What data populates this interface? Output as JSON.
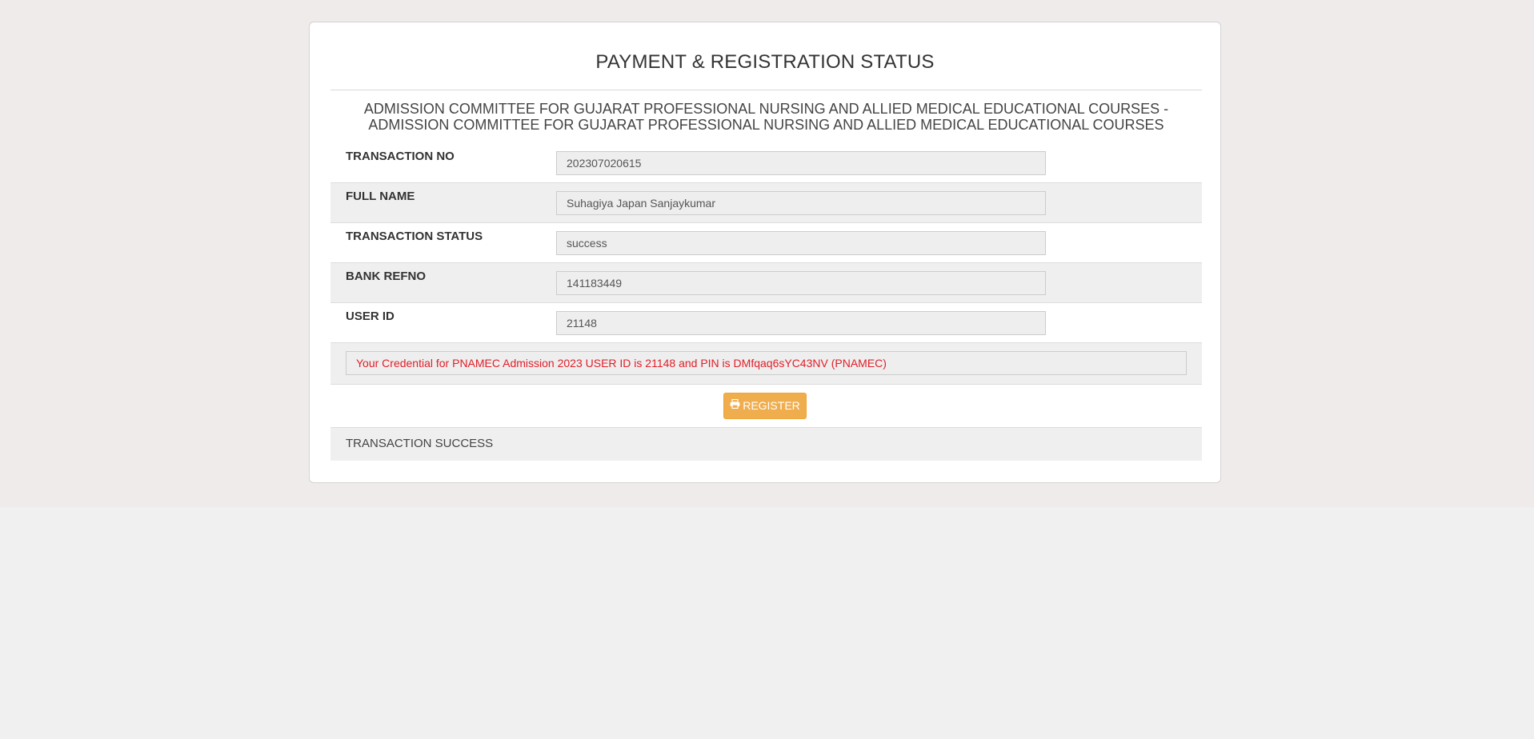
{
  "page": {
    "title": "PAYMENT & REGISTRATION STATUS",
    "organization": "ADMISSION COMMITTEE FOR GUJARAT PROFESSIONAL NURSING AND ALLIED MEDICAL EDUCATIONAL COURSES - ADMISSION COMMITTEE FOR GUJARAT PROFESSIONAL NURSING AND ALLIED MEDICAL EDUCATIONAL COURSES"
  },
  "fields": [
    {
      "label": "TRANSACTION NO",
      "value": "202307020615"
    },
    {
      "label": "FULL NAME",
      "value": "Suhagiya Japan Sanjaykumar"
    },
    {
      "label": "TRANSACTION STATUS",
      "value": "success"
    },
    {
      "label": "BANK REFNO",
      "value": "141183449"
    },
    {
      "label": "USER ID",
      "value": "21148"
    }
  ],
  "credential_message": "Your Credential for PNAMEC Admission 2023 USER ID is 21148 and PIN is DMfqaq6sYC43NV (PNAMEC)",
  "register_button": {
    "label": "REGISTER",
    "icon": "print-icon"
  },
  "status_text": "TRANSACTION SUCCESS",
  "colors": {
    "button": "#f0ad4e",
    "credential_text": "#e0202a",
    "page_background": "#efebea"
  }
}
